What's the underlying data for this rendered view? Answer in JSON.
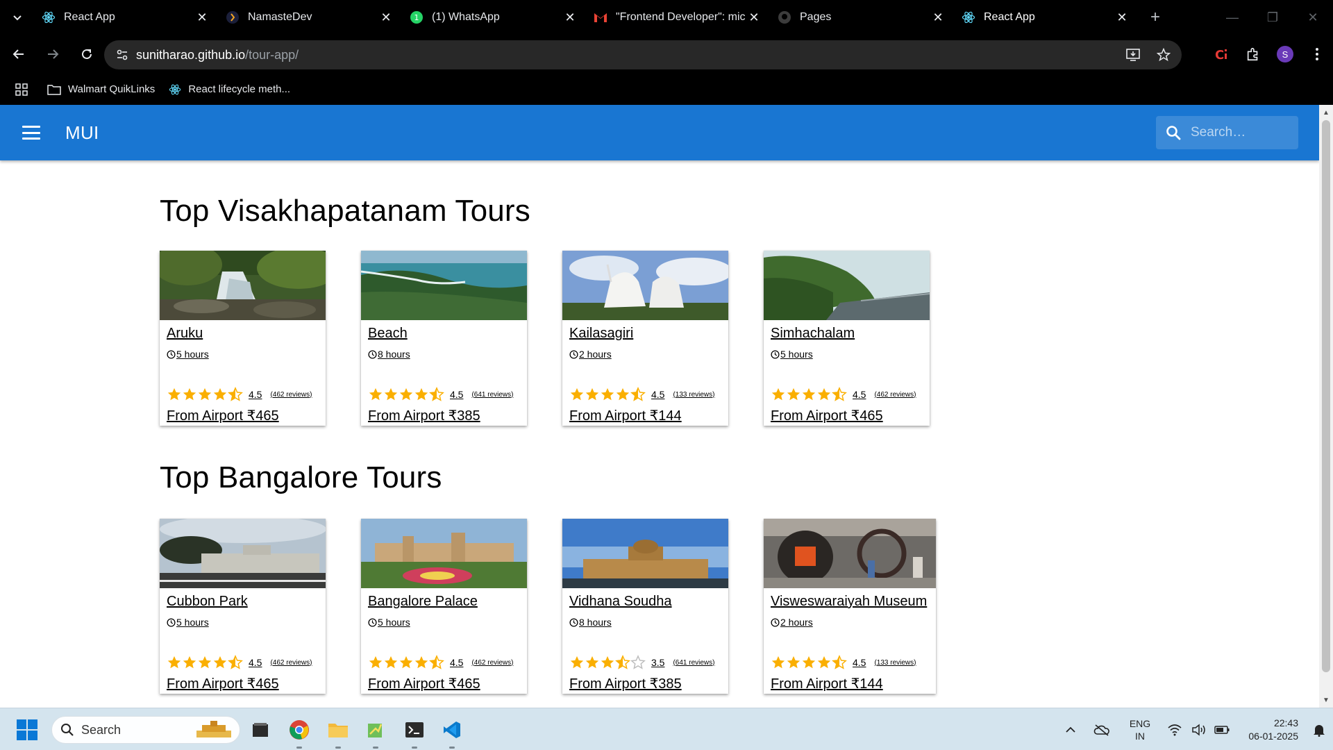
{
  "browser": {
    "tabs": [
      {
        "title": "React App",
        "icon": "react-icon",
        "active": false
      },
      {
        "title": "NamasteDev",
        "icon": "namastedev-icon",
        "active": false
      },
      {
        "title": "(1) WhatsApp",
        "icon": "whatsapp-icon",
        "active": false
      },
      {
        "title": "\"Frontend Developer\": mic",
        "icon": "gmail-icon",
        "active": false
      },
      {
        "title": "Pages",
        "icon": "github-icon",
        "active": false
      },
      {
        "title": "React App",
        "icon": "react-icon",
        "active": true
      }
    ],
    "url_host": "sunitharao.github.io",
    "url_path": "/tour-app/",
    "avatar_letter": "S",
    "bookmarks": [
      {
        "label": "Walmart QuikLinks",
        "icon": "folder-icon"
      },
      {
        "label": "React lifecycle meth...",
        "icon": "react-icon"
      }
    ]
  },
  "appbar": {
    "brand": "MUI",
    "search_placeholder": "Search…",
    "color": "#1976d2"
  },
  "sections": [
    {
      "title": "Top Visakhapatanam Tours",
      "tours": [
        {
          "name": "Aruku",
          "duration": "5 hours",
          "rating": 4.5,
          "rating_text": "4.5",
          "reviews": "(462 reviews)",
          "price": "From Airport ₹465"
        },
        {
          "name": "Beach",
          "duration": "8 hours",
          "rating": 4.5,
          "rating_text": "4.5",
          "reviews": "(641 reviews)",
          "price": "From Airport ₹385"
        },
        {
          "name": "Kailasagiri",
          "duration": "2 hours",
          "rating": 4.5,
          "rating_text": "4.5",
          "reviews": "(133 reviews)",
          "price": "From Airport ₹144"
        },
        {
          "name": "Simhachalam",
          "duration": "5 hours",
          "rating": 4.5,
          "rating_text": "4.5",
          "reviews": "(462 reviews)",
          "price": "From Airport ₹465"
        }
      ]
    },
    {
      "title": "Top Bangalore Tours",
      "tours": [
        {
          "name": "Cubbon Park",
          "duration": "5 hours",
          "rating": 4.5,
          "rating_text": "4.5",
          "reviews": "(462 reviews)",
          "price": "From Airport ₹465"
        },
        {
          "name": "Bangalore Palace",
          "duration": "5 hours",
          "rating": 4.5,
          "rating_text": "4.5",
          "reviews": "(462 reviews)",
          "price": "From Airport ₹465"
        },
        {
          "name": "Vidhana Soudha",
          "duration": "8 hours",
          "rating": 3.5,
          "rating_text": "3.5",
          "reviews": "(641 reviews)",
          "price": "From Airport ₹385"
        },
        {
          "name": "Visweswaraiyah Museum",
          "duration": "2 hours",
          "rating": 4.5,
          "rating_text": "4.5",
          "reviews": "(133 reviews)",
          "price": "From Airport ₹144"
        }
      ]
    }
  ],
  "taskbar": {
    "search_label": "Search",
    "language": "ENG",
    "region": "IN",
    "time": "22:43",
    "date": "06-01-2025",
    "apps": [
      "file-explorer-icon",
      "chrome-icon",
      "folder-icon",
      "notepad-icon",
      "terminal-icon",
      "vscode-icon"
    ]
  },
  "colors": {
    "star": "#faaf00",
    "star_empty": "#bdbdbd"
  }
}
